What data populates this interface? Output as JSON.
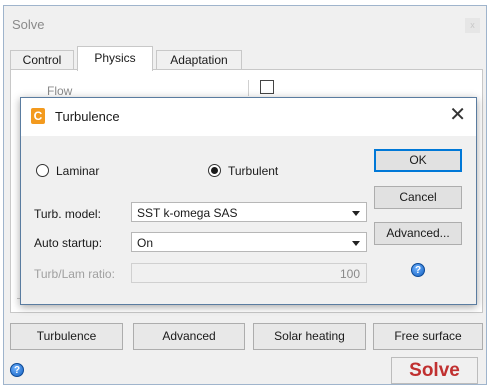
{
  "window": {
    "title": "Solve",
    "close_glyph": "x"
  },
  "tabs": [
    {
      "label": "Control",
      "active": false
    },
    {
      "label": "Physics",
      "active": true
    },
    {
      "label": "Adaptation",
      "active": false
    }
  ],
  "panel": {
    "flow_label": "Flow"
  },
  "dialog": {
    "logo_letter": "C",
    "title": "Turbulence",
    "close_glyph": "✕",
    "radios": [
      {
        "label": "Laminar",
        "checked": false
      },
      {
        "label": "Turbulent",
        "checked": true
      }
    ],
    "turb_model_label": "Turb. model:",
    "turb_model_value": "SST k-omega SAS",
    "auto_startup_label": "Auto startup:",
    "auto_startup_value": "On",
    "ratio_label": "Turb/Lam ratio:",
    "ratio_value": "100",
    "buttons": {
      "ok": "OK",
      "cancel": "Cancel",
      "advanced": "Advanced..."
    },
    "help_glyph": "?"
  },
  "bottom_buttons": [
    "Turbulence",
    "Advanced",
    "Solar heating",
    "Free surface"
  ],
  "footer": {
    "help_glyph": "?",
    "solve_label": "Solve"
  },
  "colors": {
    "solve_text": "#c03030",
    "accent": "#0078d7",
    "logo": "#f39a1e"
  }
}
